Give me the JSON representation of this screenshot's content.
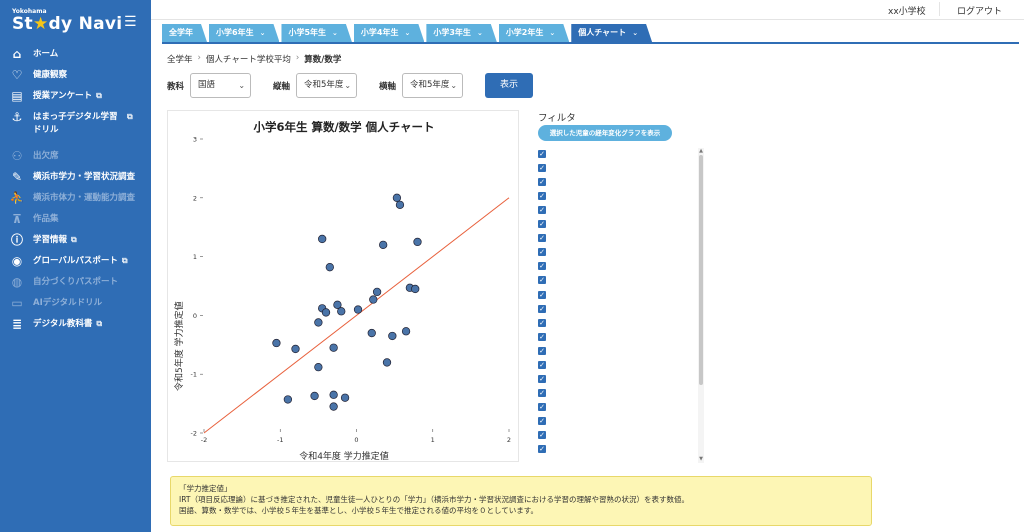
{
  "sidebar": {
    "logo_small": "Yokohama",
    "logo_brand_pre": "St",
    "logo_brand_post": "dy Navi",
    "items": [
      {
        "label": "ホーム",
        "icon": "home-icon"
      },
      {
        "label": "健康観察",
        "icon": "heart-icon"
      },
      {
        "label": "授業アンケート",
        "icon": "clipboard-icon"
      },
      {
        "label": "はまっ子デジタル学習ドリル",
        "icon": "anchor-icon"
      },
      {
        "label": "出欠席",
        "icon": "people-icon"
      },
      {
        "label": "横浜市学力・学習状況調査",
        "icon": "pencil-icon"
      },
      {
        "label": "横浜市体力・運動能力調査",
        "icon": "runner-icon"
      },
      {
        "label": "作品集",
        "icon": "easel-icon"
      },
      {
        "label": "学習情報",
        "icon": "info-icon"
      },
      {
        "label": "グローバルパスポート",
        "icon": "globe-icon"
      },
      {
        "label": "自分づくりパスポート",
        "icon": "bulb-icon"
      },
      {
        "label": "AIデジタルドリル",
        "icon": "laptop-icon"
      },
      {
        "label": "デジタル教科書",
        "icon": "books-icon"
      }
    ]
  },
  "topbar": {
    "school": "xx小学校",
    "logout": "ログアウト"
  },
  "tabs": [
    "全学年",
    "小学6年生",
    "小学5年生",
    "小学4年生",
    "小学3年生",
    "小学2年生",
    "個人チャート"
  ],
  "breadcrumb": [
    "全学年",
    "個人チャート学校平均",
    "算数/数学"
  ],
  "filters": {
    "subject_label": "教科",
    "subject_value": "国語",
    "vertical_label": "縦軸",
    "vertical_value": "令和5年度",
    "horizontal_label": "横軸",
    "horizontal_value": "令和5年度",
    "show_button": "表示"
  },
  "filter_panel": {
    "title": "フィルタ",
    "button": "選択した児童の経年変化グラフを表示",
    "check_count": 22
  },
  "info": {
    "title": "「学力推定値」",
    "line1": "IRT（項目反応理論）に基づき推定された、児童生徒一人ひとりの「学力」（横浜市学力・学習状況調査における学習の理解や習熟の状況）を表す数値。",
    "line2": "国語、算数・数学では、小学校５年生を基準とし、小学校５年生で推定される値の平均を０としています。"
  },
  "chart_data": {
    "type": "scatter",
    "title": "小学6年生 算数/数学 個人チャート",
    "xlabel": "令和4年度 学力推定値",
    "ylabel": "令和5年度 学力推定値",
    "xlim": [
      -2,
      2
    ],
    "ylim": [
      -2,
      3
    ],
    "xticks": [
      -2,
      -1,
      0,
      1,
      2
    ],
    "yticks": [
      -2,
      -1,
      0,
      1,
      2,
      3
    ],
    "point_color": "#4a74a8",
    "trend_color": "#e8603c",
    "trend_line": [
      [
        -2,
        -2
      ],
      [
        2,
        2
      ]
    ],
    "points": [
      {
        "x": 0.53,
        "y": 2.0
      },
      {
        "x": 0.57,
        "y": 1.88
      },
      {
        "x": -0.45,
        "y": 1.3
      },
      {
        "x": 0.35,
        "y": 1.2
      },
      {
        "x": 0.8,
        "y": 1.25
      },
      {
        "x": -0.35,
        "y": 0.82
      },
      {
        "x": 0.27,
        "y": 0.4
      },
      {
        "x": 0.7,
        "y": 0.47
      },
      {
        "x": 0.77,
        "y": 0.45
      },
      {
        "x": 0.22,
        "y": 0.27
      },
      {
        "x": -0.25,
        "y": 0.18
      },
      {
        "x": -0.45,
        "y": 0.12
      },
      {
        "x": -0.4,
        "y": 0.05
      },
      {
        "x": -0.2,
        "y": 0.07
      },
      {
        "x": 0.02,
        "y": 0.1
      },
      {
        "x": -0.5,
        "y": -0.12
      },
      {
        "x": 0.2,
        "y": -0.3
      },
      {
        "x": 0.65,
        "y": -0.27
      },
      {
        "x": 0.47,
        "y": -0.35
      },
      {
        "x": -1.05,
        "y": -0.47
      },
      {
        "x": -0.8,
        "y": -0.57
      },
      {
        "x": -0.3,
        "y": -0.55
      },
      {
        "x": 0.4,
        "y": -0.8
      },
      {
        "x": -0.5,
        "y": -0.88
      },
      {
        "x": -0.55,
        "y": -1.37
      },
      {
        "x": -0.3,
        "y": -1.35
      },
      {
        "x": -0.15,
        "y": -1.4
      },
      {
        "x": -0.9,
        "y": -1.43
      },
      {
        "x": -0.3,
        "y": -1.55
      }
    ]
  }
}
